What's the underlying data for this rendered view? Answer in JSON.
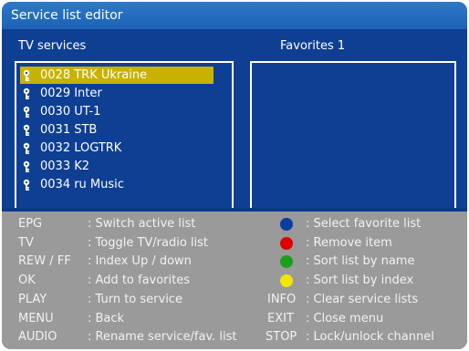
{
  "title": "Service list editor",
  "left_panel": {
    "header": "TV services",
    "items": [
      {
        "label": "0028 TRK Ukraine",
        "selected": true
      },
      {
        "label": "0029 Inter",
        "selected": false
      },
      {
        "label": "0030 UT-1",
        "selected": false
      },
      {
        "label": "0031 STB",
        "selected": false
      },
      {
        "label": "0032 LOGTRK",
        "selected": false
      },
      {
        "label": "0033 K2",
        "selected": false
      },
      {
        "label": "0034 ru Music",
        "selected": false
      }
    ]
  },
  "right_panel": {
    "header": "Favorites 1",
    "items": []
  },
  "help": {
    "left": [
      {
        "key": "EPG",
        "desc": ": Switch active list"
      },
      {
        "key": "TV",
        "desc": ": Toggle TV/radio list"
      },
      {
        "key": "REW / FF",
        "desc": ": Index Up / down"
      },
      {
        "key": "OK",
        "desc": ": Add to favorites"
      },
      {
        "key": "PLAY",
        "desc": ": Turn to service"
      },
      {
        "key": "MENU",
        "desc": ": Back"
      },
      {
        "key": "AUDIO",
        "desc": ": Rename service/fav. list"
      }
    ],
    "right": [
      {
        "key": "",
        "color": "#0a3fa0",
        "desc": ": Select favorite list"
      },
      {
        "key": "",
        "color": "#e00000",
        "desc": ": Remove item"
      },
      {
        "key": "",
        "color": "#1aa11a",
        "desc": ": Sort list by name"
      },
      {
        "key": "",
        "color": "#f2e600",
        "desc": ": Sort list by index"
      },
      {
        "key": "INFO",
        "color": "",
        "desc": ": Clear service lists"
      },
      {
        "key": "EXIT",
        "color": "",
        "desc": ": Close menu"
      },
      {
        "key": "STOP",
        "color": "",
        "desc": ": Lock/unlock channel"
      }
    ]
  },
  "colors": {
    "title_bar": "#1c62b6",
    "panel_bg": "#0e3f93",
    "selection": "#c7b200",
    "help_bg": "#9a9a9a"
  },
  "icons": {
    "lock": "key-icon"
  }
}
